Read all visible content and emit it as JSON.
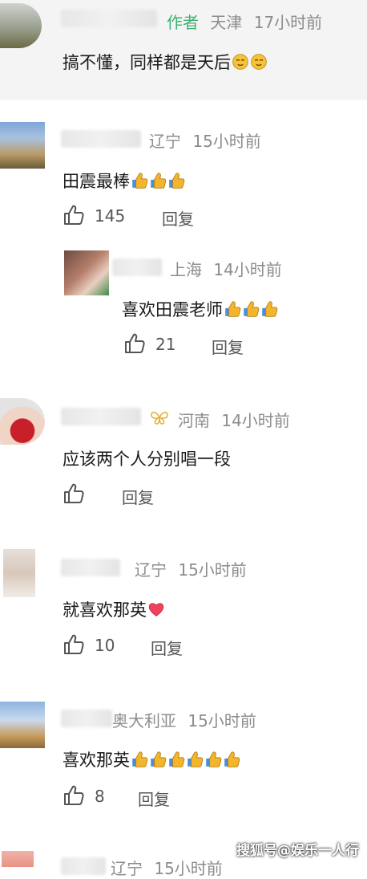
{
  "comments": [
    {
      "author_tag": "作者",
      "location": "天津",
      "time": "17小时前",
      "text": "搞不懂，同样都是天后",
      "emojis": [
        "face-icon",
        "face-icon"
      ]
    },
    {
      "location": "辽宁",
      "time": "15小时前",
      "text": "田震最棒",
      "likes": "145",
      "reply_label": "回复",
      "thumbs_count": 3
    },
    {
      "location": "上海",
      "time": "14小时前",
      "text": "喜欢田震老师",
      "likes": "21",
      "reply_label": "回复",
      "thumbs_count": 3
    },
    {
      "location": "河南",
      "time": "14小时前",
      "text": "应该两个人分别唱一段",
      "reply_label": "回复"
    },
    {
      "location": "辽宁",
      "time": "15小时前",
      "text": "就喜欢那英",
      "likes": "10",
      "reply_label": "回复"
    },
    {
      "location": "奥大利亚",
      "time": "15小时前",
      "text": "喜欢那英",
      "likes": "8",
      "reply_label": "回复",
      "thumbs_count": 6
    },
    {
      "location": "辽宁",
      "time": "15小时前"
    }
  ],
  "watermark": "搜狐号@娱乐一人行",
  "colors": {
    "author_tag": "#3bb26f",
    "meta": "#8c8c8c",
    "top_band": "#f4f4f4"
  }
}
